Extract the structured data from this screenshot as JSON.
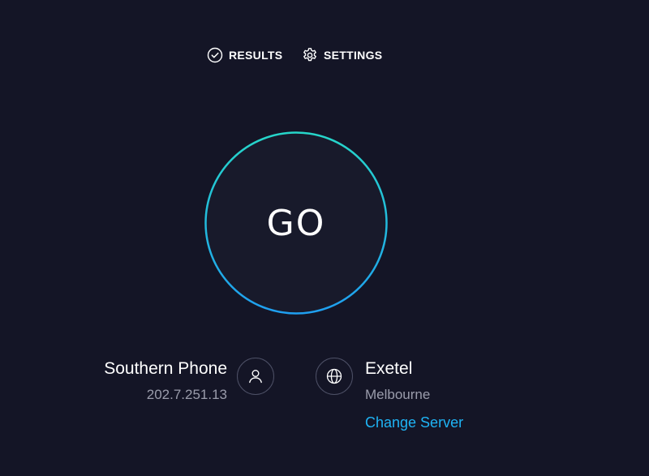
{
  "nav": {
    "results_label": "RESULTS",
    "settings_label": "SETTINGS"
  },
  "go_button": {
    "label": "GO",
    "gradient_start": "#26d6c9",
    "gradient_end": "#1f9ff0"
  },
  "isp": {
    "name": "Southern Phone",
    "ip": "202.7.251.13",
    "icon": "user-icon"
  },
  "server": {
    "name": "Exetel",
    "location": "Melbourne",
    "change_label": "Change Server",
    "icon": "globe-icon"
  },
  "colors": {
    "background": "#141526",
    "muted_text": "#9a9cab",
    "link": "#1fb4f5"
  }
}
